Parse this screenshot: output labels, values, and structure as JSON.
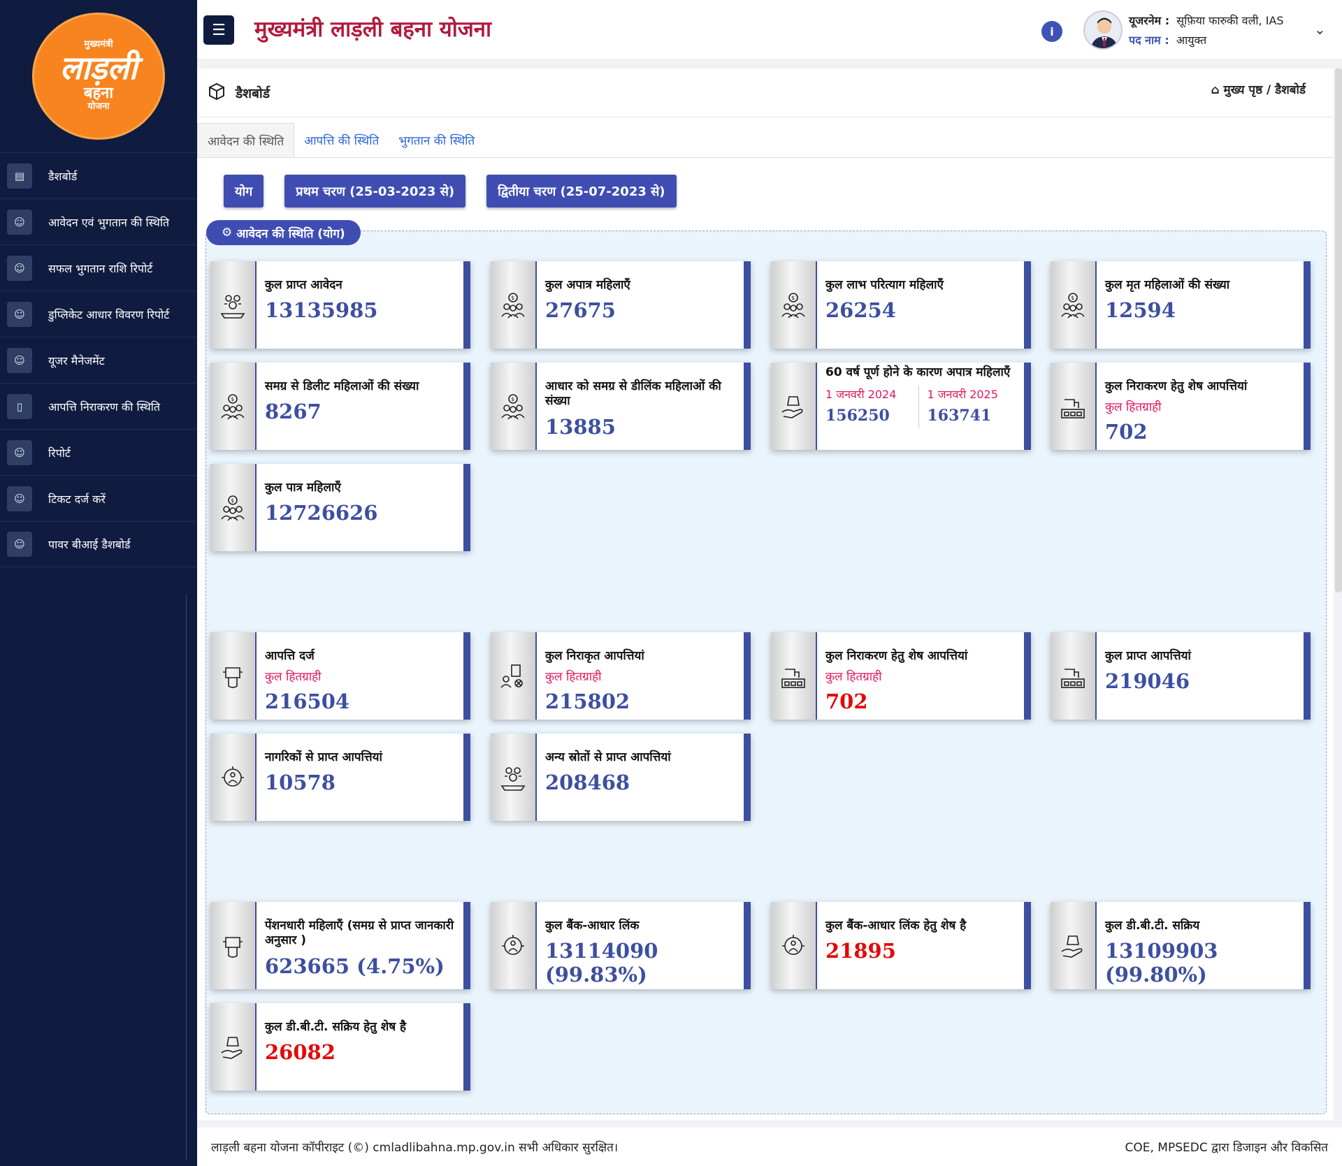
{
  "sidebar": {
    "logo": {
      "line1": "मुख्यमंत्री",
      "line2": "लाड़ली",
      "line3": "बहना",
      "line4": "योजना"
    },
    "items": [
      {
        "label": "डैशबोर्ड"
      },
      {
        "label": "आवेदन एवं भुगतान की स्थिति"
      },
      {
        "label": "सफल भुगतान राशि रिपोर्ट"
      },
      {
        "label": "डुप्लिकेट आधार विवरण रिपोर्ट"
      },
      {
        "label": "यूजर मैनेजमेंट"
      },
      {
        "label": "आपत्ति निराकरण की स्थिति"
      },
      {
        "label": "रिपोर्ट"
      },
      {
        "label": "टिकट दर्ज करें"
      },
      {
        "label": "पावर बीआई डैशबोर्ड"
      }
    ]
  },
  "header": {
    "title": "मुख्यमंत्री लाड़ली बहना योजना",
    "username_key": "यूजरनेम :",
    "username": "सूफ़िया फारुकी वली, IAS",
    "designation_key": "पद नाम :",
    "designation": "आयुक्त"
  },
  "page": {
    "title": "डैशबोर्ड",
    "breadcrumb": "मुख्य पृष्ठ / डैशबोर्ड"
  },
  "tabs": [
    "आवेदन की स्थिति",
    "आपत्ति की स्थिति",
    "भुगतान की स्थिति"
  ],
  "buttons": [
    "योग",
    "प्रथम चरण (25-03-2023 से)",
    "द्वितीया चरण (25-07-2023 से)"
  ],
  "section_legend": "आवेदन की स्थिति (योग)",
  "cards": [
    {
      "label": "कुल प्राप्त आवेदन",
      "value": "13135985"
    },
    {
      "label": "कुल अपात्र महिलाएँ",
      "value": "27675"
    },
    {
      "label": "कुल लाभ परित्याग महिलाएँ",
      "value": "26254"
    },
    {
      "label": "कुल मृत महिलाओं की संख्या",
      "value": "12594"
    },
    {
      "label": "समग्र से डिलीट महिलाओं की संख्या",
      "value": "8267"
    },
    {
      "label": "आधार को समग्र से डीलिंक महिलाओं की संख्या",
      "value": "13885"
    },
    {
      "label": "60 वर्ष पूर्ण होने के कारण अपात्र महिलाएँ",
      "split_a_label": "1 जनवरी 2024",
      "split_a_value": "156250",
      "split_b_label": "1 जनवरी 2025",
      "split_b_value": "163741"
    },
    {
      "label": "कुल निराकरण हेतु शेष आपत्तियां",
      "sub": "कुल हितग्राही",
      "value": "702"
    },
    {
      "label": "कुल पात्र महिलाएँ",
      "value": "12726626"
    },
    {
      "label": "आपत्ति दर्ज",
      "sub": "कुल हितग्राही",
      "value": "216504"
    },
    {
      "label": "कुल निराकृत आपत्तियां",
      "sub": "कुल हितग्राही",
      "value": "215802"
    },
    {
      "label": "कुल निराकरण हेतु शेष आपत्तियां",
      "sub": "कुल हितग्राही",
      "value": "702"
    },
    {
      "label": "कुल प्राप्त आपत्तियां",
      "value": "219046"
    },
    {
      "label": "नागरिकों से प्राप्त आपत्तियां",
      "value": "10578"
    },
    {
      "label": "अन्य स्रोतों से प्राप्त आपत्तियां",
      "value": "208468"
    },
    {
      "label": "पेंशनधारी महिलाएँ (समग्र से प्राप्त जानकारी अनुसार )",
      "value": "623665 (4.75%)"
    },
    {
      "label": "कुल बैंक-आधार लिंक",
      "value": "13114090 (99.83%)"
    },
    {
      "label": "कुल बैंक-आधार लिंक हेतु शेष है",
      "value": "21895"
    },
    {
      "label": "कुल डी.बी.टी. सक्रिय",
      "value": "13109903 (99.80%)"
    },
    {
      "label": "कुल डी.बी.टी. सक्रिय हेतु शेष है",
      "value": "26082"
    }
  ],
  "footer": {
    "left": "लाड़ली बहना योजना कॉपीराइट (©)  cmladlibahna.mp.gov.in  सभी अधिकार सुरक्षित।",
    "right": "COE,  MPSEDC  द्वारा डिजाइन और विकसित"
  },
  "colors": {
    "sidebar": "#0f1c3f",
    "accent": "#3d4fa0",
    "title": "#b3193d",
    "red": "#e40909",
    "logo": "#f7841f"
  }
}
